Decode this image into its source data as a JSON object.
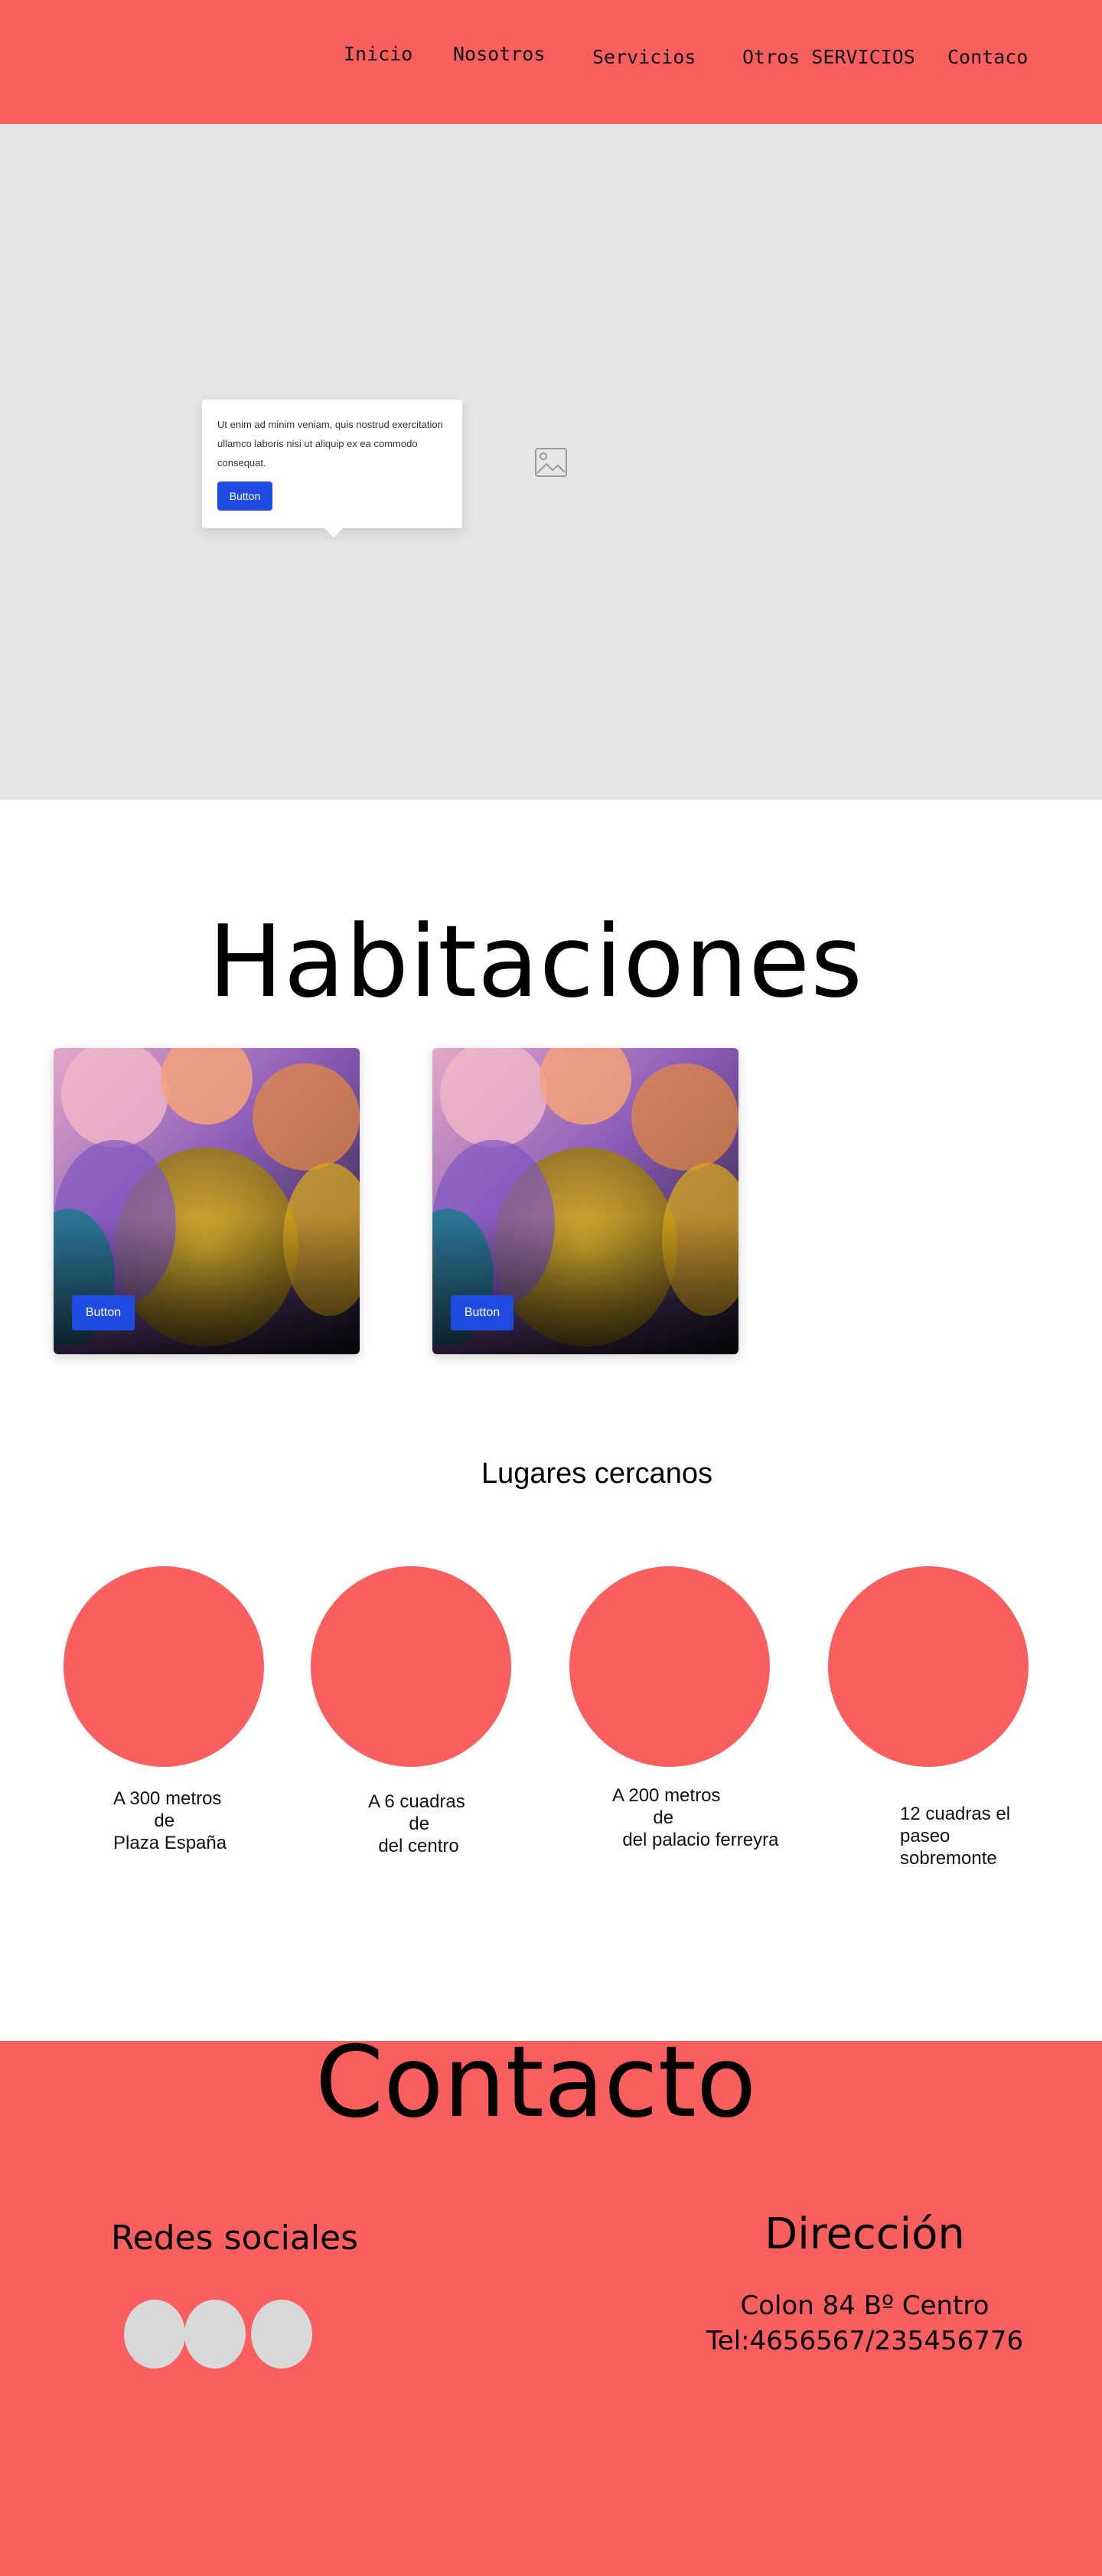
{
  "nav": {
    "items": [
      "Inicio",
      "Nosotros",
      "Servicios",
      "Otros SERVICIOS",
      "Contaco"
    ]
  },
  "hero": {
    "popover_text": "Ut enim ad minim veniam, quis nostrud exercitation ullamco laboris nisi ut aliquip ex ea commodo consequat.",
    "popover_button": "Button",
    "image_icon": "image-placeholder-icon"
  },
  "habitaciones": {
    "title": "Habitaciones",
    "cards": [
      {
        "button": "Button"
      },
      {
        "button": "Button"
      }
    ]
  },
  "lugares": {
    "title": "Lugares cercanos",
    "items": [
      {
        "text": "A 300 metros\n        de\nPlaza España"
      },
      {
        "text": "A 6 cuadras\n        de\n  del centro"
      },
      {
        "text": "A 200 metros\n        de\n  del palacio ferreyra"
      },
      {
        "text": "12 cuadras el\npaseo\nsobremonte"
      }
    ]
  },
  "contacto": {
    "title": "Contacto",
    "redes_title": "Redes sociales",
    "direccion_title": "Dirección",
    "address": "Colon 84 Bº Centro",
    "phone": "Tel:4656567/235456776"
  },
  "colors": {
    "accent": "#f95f5f",
    "button": "#1f4be0",
    "hero_bg": "#e6e6e6",
    "social_circle": "#d9d9d9"
  }
}
